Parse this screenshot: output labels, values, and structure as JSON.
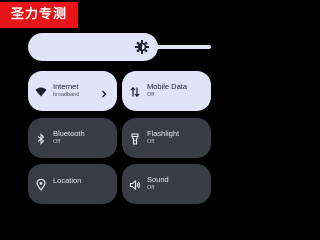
{
  "watermark": {
    "text": "圣力专测"
  },
  "brightness": {
    "level": 0.71,
    "icon": "brightness-icon"
  },
  "tiles": [
    {
      "label": "Internet",
      "sub": "broadband",
      "state": "on",
      "icon": "wifi-icon",
      "has_chevron": true
    },
    {
      "label": "Mobile Data",
      "sub": "Off",
      "state": "on",
      "icon": "mobile-data-icon"
    },
    {
      "label": "Bluetooth",
      "sub": "Off",
      "state": "off",
      "icon": "bluetooth-icon"
    },
    {
      "label": "Flashlight",
      "sub": "Off",
      "state": "off",
      "icon": "flashlight-icon"
    },
    {
      "label": "Location",
      "sub": "",
      "state": "off",
      "icon": "location-icon"
    },
    {
      "label": "Sound",
      "sub": "Off",
      "state": "off",
      "icon": "sound-icon"
    }
  ],
  "colors": {
    "background": "#000000",
    "tile_on": "#dfe4f8",
    "tile_off": "#393c45",
    "watermark": "#e81418"
  }
}
